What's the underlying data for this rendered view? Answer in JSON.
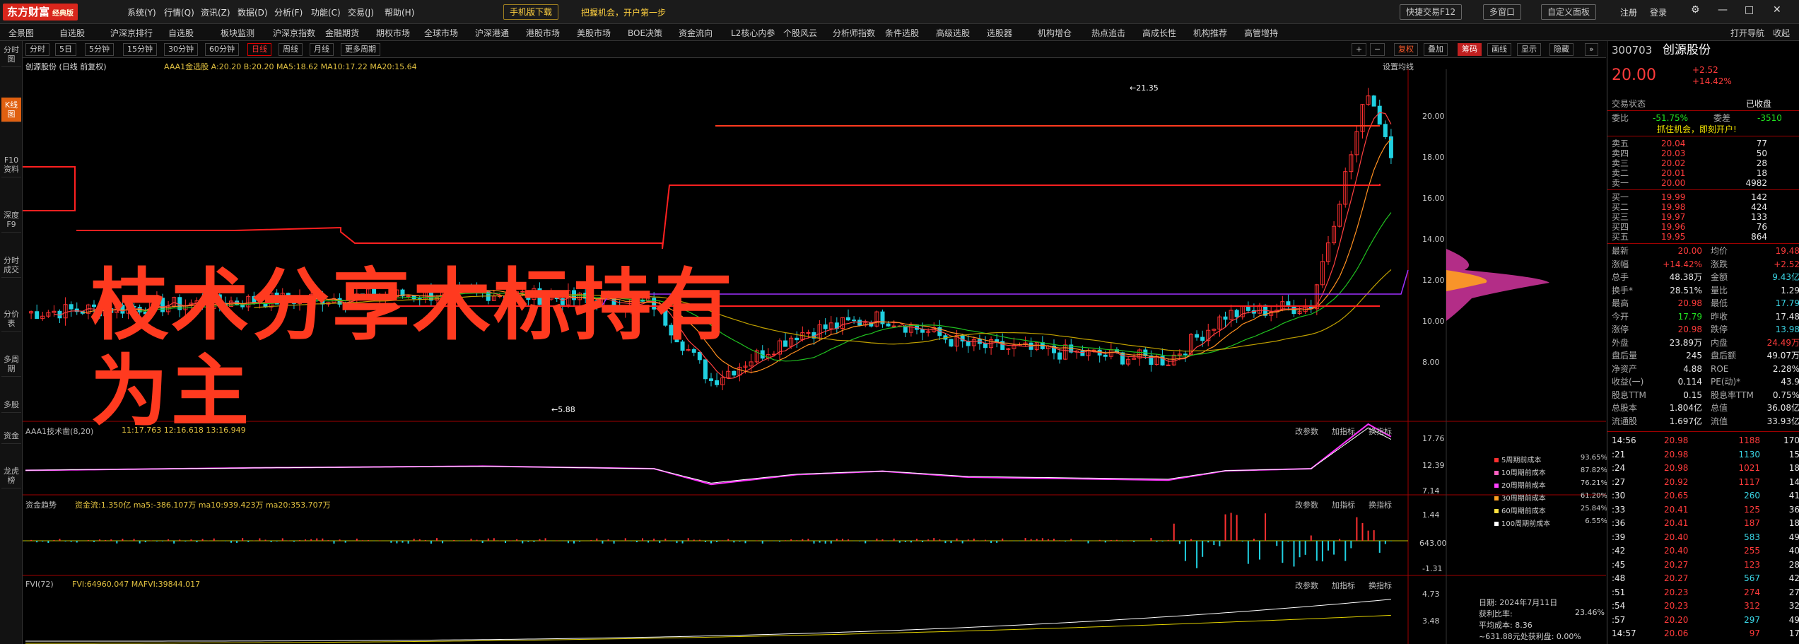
{
  "titlebar": {
    "logo": "东方财富",
    "edition": "经典版",
    "menus": [
      "系统(Y)",
      "行情(Q)",
      "资讯(Z)",
      "数据(D)",
      "分析(F)",
      "功能(C)",
      "交易(J)",
      "帮助(H)"
    ],
    "download": "手机版下载",
    "promo": "把握机会，开户第一步",
    "quick": "快捷交易F12",
    "multi": "多窗口",
    "custom": "自定义面板",
    "login": "注册",
    "logout": "登录"
  },
  "navbar": {
    "items": [
      "全景图",
      "自选股",
      "沪深京排行",
      "自选股",
      "板块监测",
      "沪深京指数",
      "金融期货",
      "期权市场",
      "全球市场",
      "沪深港通",
      "港股市场",
      "美股市场",
      "BOE决策",
      "资金流向",
      "L2核心内参",
      "个股风云",
      "分析师指数",
      "条件选股",
      "高级选股",
      "选股器",
      "机构增仓",
      "热点追击",
      "高成长性",
      "机构推荐",
      "高管增持"
    ],
    "right": [
      "打开导航",
      "收起"
    ]
  },
  "leftbar": [
    "分时图",
    "K线图",
    "F10资料",
    "深度F9",
    "分时成交",
    "分价表",
    "多周期",
    "多股",
    "资金",
    "龙虎榜"
  ],
  "periodbar": {
    "items": [
      "分时",
      "5日",
      "5分钟",
      "15分钟",
      "30分钟",
      "60分钟",
      "日线",
      "周线",
      "月线",
      "更多周期"
    ],
    "active": "日线",
    "right": [
      "复权",
      "叠加",
      "筹码",
      "画线",
      "显示",
      "隐藏"
    ]
  },
  "chart": {
    "stock_label": "创源股份 (日线 前复权)",
    "indicator_top": "AAA1金选股 A:20.20  B:20.20  MA5:18.62  MA10:17.22  MA20:15.64",
    "settings": "设置均线",
    "max_label": "21.35",
    "min_label": "5.88",
    "axis_main": [
      "20.00",
      "18.00",
      "16.00",
      "14.00",
      "12.00",
      "10.00",
      "8.00"
    ],
    "overlay_text": [
      "枝术分享木标持有",
      "为主"
    ],
    "sub1": {
      "label": "AAA1技术凿(8,20)",
      "values": "11:17.763  12:16.618  13:16.949",
      "axis": [
        "17.76",
        "12.39",
        "7.14"
      ],
      "btns": [
        "改参数",
        "加指标",
        "换指标"
      ]
    },
    "sub2": {
      "label": "资金趋势",
      "values": "资金流:1.350亿  ma5:-386.107万  ma10:939.423万  ma20:353.707万",
      "axis": [
        "1.44",
        "643.00",
        "-1.31"
      ],
      "btns": [
        "改参数",
        "加指标",
        "换指标"
      ]
    },
    "sub3": {
      "label": "FVI(72)",
      "values": "FVI:64960.047  MAFVI:39844.017",
      "axis": [
        "4.73",
        "3.48"
      ],
      "btns": [
        "改参数",
        "加指标",
        "换指标"
      ]
    }
  },
  "chip_legend": [
    {
      "label": "5周期前成本",
      "val": "93.65%",
      "color": "#ff3030"
    },
    {
      "label": "10周期前成本",
      "val": "87.82%",
      "color": "#ff60c0"
    },
    {
      "label": "20周期前成本",
      "val": "76.21%",
      "color": "#ff40ff"
    },
    {
      "label": "30周期前成本",
      "val": "61.20%",
      "color": "#ffa020"
    },
    {
      "label": "60周期前成本",
      "val": "25.84%",
      "color": "#ffe040"
    },
    {
      "label": "100周期前成本",
      "val": "6.55%",
      "color": "#ffffff"
    }
  ],
  "chip_info": {
    "date": "日期: 2024年7月11日",
    "profit": "获利比率:",
    "profit_val": "23.46%",
    "avg": "平均成本: 8.36",
    "ratio": "~631.88元处获利盘: 0.00%"
  },
  "quote": {
    "code": "300703",
    "name": "创源股份",
    "price": "20.00",
    "change": "+2.52",
    "pct": "+14.42%",
    "status": "交易状态",
    "status_val": "已收盘",
    "wb": "委比",
    "wb_val": "-51.75%",
    "wc": "委差",
    "wc_val": "-3510",
    "promo": "抓住机会，即刻开户!",
    "asks": [
      [
        "卖五",
        "20.04",
        "77"
      ],
      [
        "卖四",
        "20.03",
        "50"
      ],
      [
        "卖三",
        "20.02",
        "28"
      ],
      [
        "卖二",
        "20.01",
        "18"
      ],
      [
        "卖一",
        "20.00",
        "4982"
      ]
    ],
    "bids": [
      [
        "买一",
        "19.99",
        "142"
      ],
      [
        "买二",
        "19.98",
        "424"
      ],
      [
        "买三",
        "19.97",
        "133"
      ],
      [
        "买四",
        "19.96",
        "76"
      ],
      [
        "买五",
        "19.95",
        "864"
      ]
    ],
    "stats": [
      [
        "最新",
        "20.00",
        "均价",
        "19.48"
      ],
      [
        "涨幅",
        "+14.42%",
        "涨跌",
        "+2.52"
      ],
      [
        "总手",
        "48.38万",
        "金额",
        "9.43亿"
      ],
      [
        "换手*",
        "28.51%",
        "量比",
        "1.29"
      ],
      [
        "最高",
        "20.98",
        "最低",
        "17.79"
      ],
      [
        "今开",
        "17.79",
        "昨收",
        "17.48"
      ],
      [
        "涨停",
        "20.98",
        "跌停",
        "13.98"
      ],
      [
        "外盘",
        "23.89万",
        "内盘",
        "24.49万"
      ],
      [
        "盘后量",
        "245",
        "盘后额",
        "49.07万"
      ],
      [
        "净资产",
        "4.88",
        "ROE",
        "2.28%"
      ],
      [
        "收益(一)",
        "0.114",
        "PE(动)*",
        "43.9"
      ],
      [
        "股息TTM",
        "0.15",
        "股息率TTM",
        "0.75%"
      ],
      [
        "总股本",
        "1.804亿",
        "总值",
        "36.08亿"
      ],
      [
        "流通股",
        "1.697亿",
        "流值",
        "33.93亿"
      ]
    ],
    "ticks": [
      [
        "14:56",
        "20.98",
        "1188",
        "170"
      ],
      [
        ":21",
        "20.98",
        "1130",
        "15"
      ],
      [
        ":24",
        "20.98",
        "1021",
        "18"
      ],
      [
        ":27",
        "20.92",
        "1117",
        "14"
      ],
      [
        ":30",
        "20.65",
        "260",
        "41"
      ],
      [
        ":33",
        "20.41",
        "125",
        "36"
      ],
      [
        ":36",
        "20.41",
        "187",
        "18"
      ],
      [
        ":39",
        "20.40",
        "583",
        "49"
      ],
      [
        ":42",
        "20.40",
        "255",
        "40"
      ],
      [
        ":45",
        "20.27",
        "123",
        "28"
      ],
      [
        ":48",
        "20.27",
        "567",
        "42"
      ],
      [
        ":51",
        "20.23",
        "274",
        "27"
      ],
      [
        ":54",
        "20.23",
        "312",
        "32"
      ],
      [
        ":57",
        "20.20",
        "297",
        "49"
      ],
      [
        "14:57",
        "20.06",
        "97",
        "17"
      ]
    ]
  }
}
